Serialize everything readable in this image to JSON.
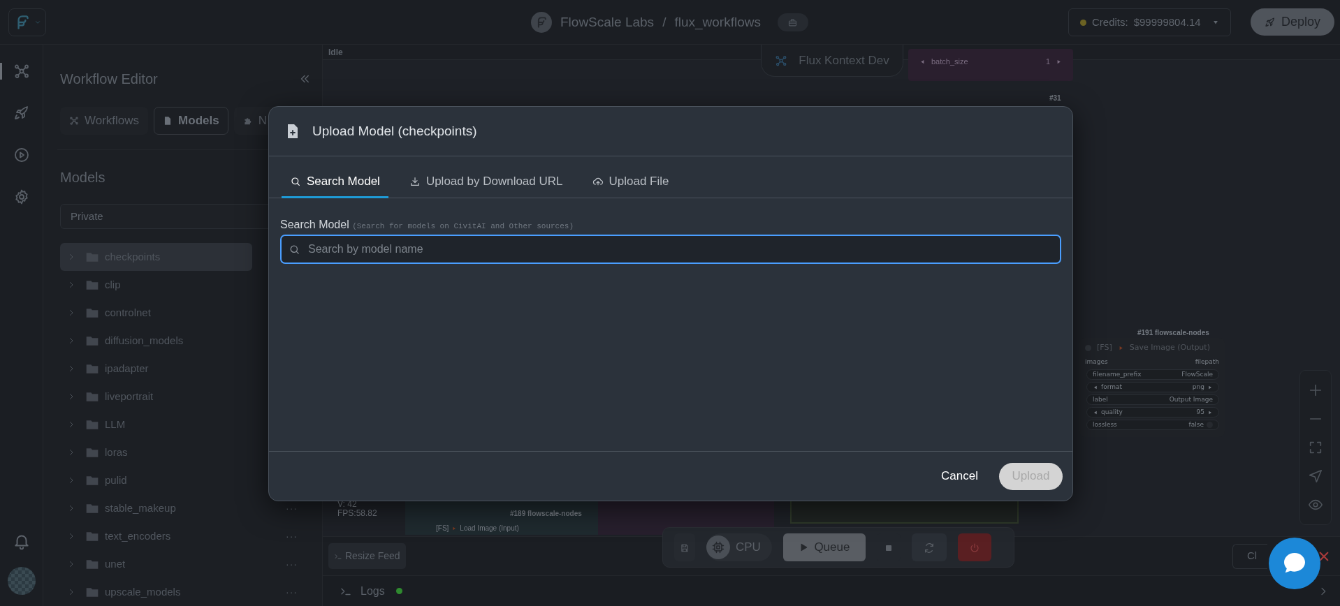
{
  "top_bar": {
    "org": "FlowScale Labs",
    "separator": "/",
    "project": "flux_workflows",
    "credits_label": "Credits:",
    "credits_value": "$99999804.14",
    "deploy": "Deploy"
  },
  "rail": {
    "items": [
      {
        "kind": "workflow",
        "selected": true
      },
      {
        "kind": "rocket",
        "selected": false
      },
      {
        "kind": "play",
        "selected": false
      },
      {
        "kind": "settings",
        "selected": false
      }
    ]
  },
  "sidebar": {
    "title": "Workflow Editor",
    "tabs": [
      {
        "kind": "workflow",
        "label": "Workflows",
        "selected": false
      },
      {
        "kind": "file",
        "label": "Models",
        "selected": true
      },
      {
        "kind": "puzzle",
        "label": "N",
        "selected": false
      }
    ],
    "section_title": "Models",
    "filter": {
      "value": "Private"
    },
    "folders": [
      {
        "name": "checkpoints",
        "selected": true
      },
      {
        "name": "clip",
        "selected": false
      },
      {
        "name": "controlnet",
        "selected": false
      },
      {
        "name": "diffusion_models",
        "selected": false
      },
      {
        "name": "ipadapter",
        "selected": false
      },
      {
        "name": "liveportrait",
        "selected": false
      },
      {
        "name": "LLM",
        "selected": false
      },
      {
        "name": "loras",
        "selected": false
      },
      {
        "name": "pulid",
        "selected": false
      },
      {
        "name": "stable_makeup",
        "selected": false,
        "more": "···"
      },
      {
        "name": "text_encoders",
        "selected": false,
        "more": "···"
      },
      {
        "name": "unet",
        "selected": false,
        "more": "···"
      },
      {
        "name": "upscale_models",
        "selected": false,
        "more": "···"
      }
    ]
  },
  "canvas": {
    "status": "Idle",
    "workflow_chip": "Flux Kontext Dev",
    "batch_node": {
      "widget": "batch_size",
      "value": "1"
    },
    "node_31": "#31",
    "save_node": {
      "id_label": "#191 flowscale-nodes",
      "prefix": "[FS]",
      "title": "Save Image (Output)",
      "input": "images",
      "output": "filepath",
      "widgets": [
        {
          "kind": "text",
          "name": "filename_prefix",
          "value": "FlowScale"
        },
        {
          "kind": "combo",
          "name": "format",
          "value": "png"
        },
        {
          "kind": "text",
          "name": "label",
          "value": "Output Image"
        },
        {
          "kind": "number",
          "name": "quality",
          "value": "95"
        },
        {
          "kind": "toggle",
          "name": "lossless",
          "value": "false"
        }
      ]
    },
    "stats": [
      "V: 42",
      "FPS:58.82"
    ],
    "load_node": {
      "id_label": "#189 flowscale-nodes",
      "prefix": "[FS]",
      "title": "Load Image (Input)"
    },
    "resize_button": "Resize Feed",
    "close_button": "Cl"
  },
  "toolbar": {
    "device": "CPU",
    "queue": "Queue"
  },
  "logs": {
    "label": "Logs",
    "online": true
  },
  "modal": {
    "title": "Upload Model (checkpoints)",
    "tabs": [
      {
        "kind": "search",
        "label": "Search Model",
        "selected": true
      },
      {
        "kind": "download",
        "label": "Upload by Download URL",
        "selected": false
      },
      {
        "kind": "upload",
        "label": "Upload File",
        "selected": false
      }
    ],
    "search": {
      "label": "Search Model",
      "hint": "(Search for models on CivitAI and Other sources)",
      "placeholder": "Search by model name"
    },
    "cancel": "Cancel",
    "upload": {
      "label": "Upload",
      "disabled": true
    }
  }
}
